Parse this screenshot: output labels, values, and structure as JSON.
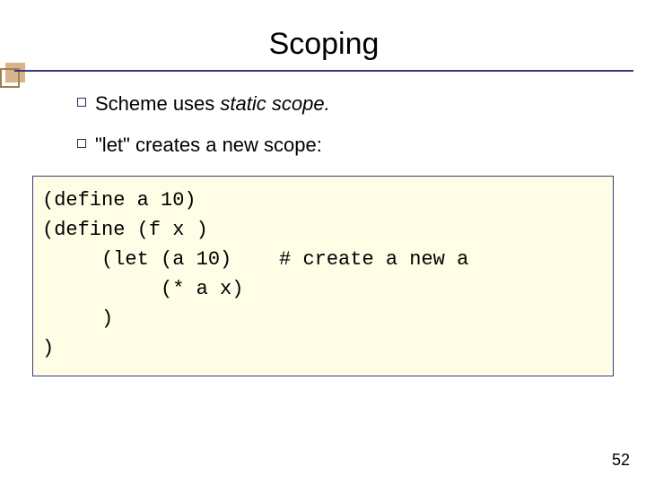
{
  "title": "Scoping",
  "bullets": [
    {
      "pre": "Scheme uses ",
      "italic": "static scope.",
      "post": ""
    },
    {
      "pre": "\"let\" creates a new scope:",
      "italic": "",
      "post": ""
    }
  ],
  "code": {
    "l1": "(define a 10)",
    "l2": "(define (f x )",
    "l3": "     (let (a 10)    # create a new a",
    "l4": "          (* a x)",
    "l5": "     )",
    "l6": ")"
  },
  "page_number": "52"
}
